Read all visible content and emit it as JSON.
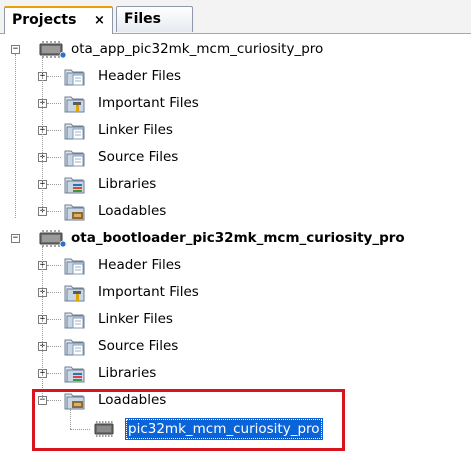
{
  "tabs": [
    {
      "label": "Projects",
      "close": "×",
      "active": true
    },
    {
      "label": "Files",
      "active": false
    }
  ],
  "projects": [
    {
      "name": "ota_app_pic32mk_mcm_curiosity_pro",
      "bold": false,
      "expanded": true,
      "folders": [
        {
          "label": "Header Files",
          "icon": "folder-icon",
          "expanded": false
        },
        {
          "label": "Important Files",
          "icon": "important-folder-icon",
          "expanded": false
        },
        {
          "label": "Linker Files",
          "icon": "folder-icon",
          "expanded": false
        },
        {
          "label": "Source Files",
          "icon": "folder-icon",
          "expanded": false
        },
        {
          "label": "Libraries",
          "icon": "libraries-folder-icon",
          "expanded": false
        },
        {
          "label": "Loadables",
          "icon": "loadables-folder-icon",
          "expanded": false
        }
      ]
    },
    {
      "name": "ota_bootloader_pic32mk_mcm_curiosity_pro",
      "bold": true,
      "expanded": true,
      "folders": [
        {
          "label": "Header Files",
          "icon": "folder-icon",
          "expanded": false
        },
        {
          "label": "Important Files",
          "icon": "important-folder-icon",
          "expanded": false
        },
        {
          "label": "Linker Files",
          "icon": "folder-icon",
          "expanded": false
        },
        {
          "label": "Source Files",
          "icon": "folder-icon",
          "expanded": false
        },
        {
          "label": "Libraries",
          "icon": "libraries-folder-icon",
          "expanded": false
        },
        {
          "label": "Loadables",
          "icon": "loadables-folder-icon",
          "expanded": true,
          "children": [
            {
              "label": "pic32mk_mcm_curiosity_pro",
              "icon": "chip-icon",
              "selected": true
            }
          ]
        }
      ]
    }
  ],
  "colors": {
    "selection": "#0a64d9",
    "highlight_box": "#d8141c",
    "active_tab_accent": "#e8a300"
  }
}
